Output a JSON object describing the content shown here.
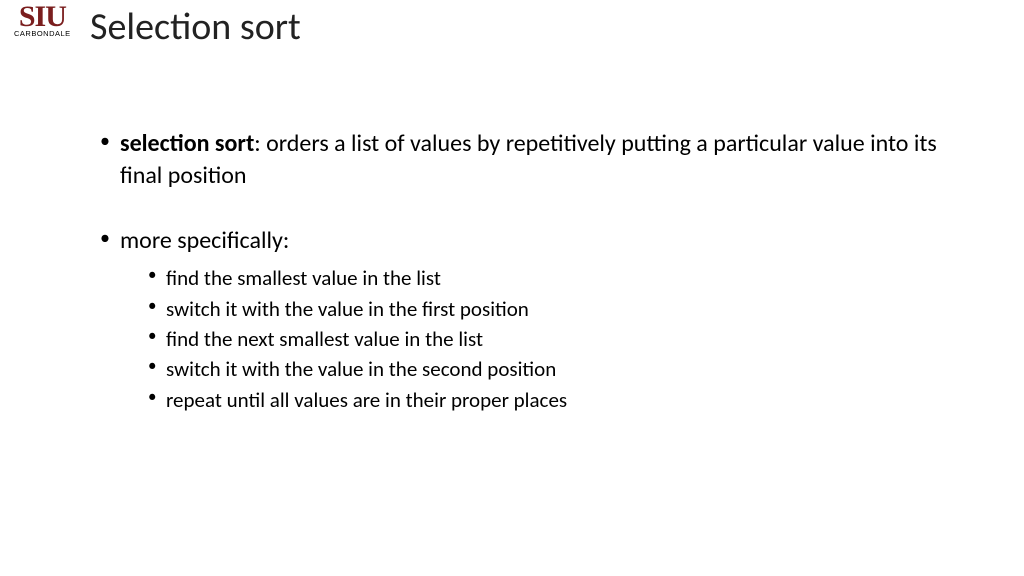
{
  "logo": {
    "main": "SIU",
    "sub": "CARBONDALE"
  },
  "title": "Selection sort",
  "bullets": [
    {
      "strong": "selection sort",
      "rest": ": orders a list of values by repetitively putting a particular value into its final position"
    },
    {
      "text": "more specifically:",
      "sub": [
        "find the smallest value in the list",
        "switch it with the value in the first position",
        "find the next smallest value in the list",
        "switch it with the value in the second position",
        "repeat until all values are in their proper places"
      ]
    }
  ]
}
